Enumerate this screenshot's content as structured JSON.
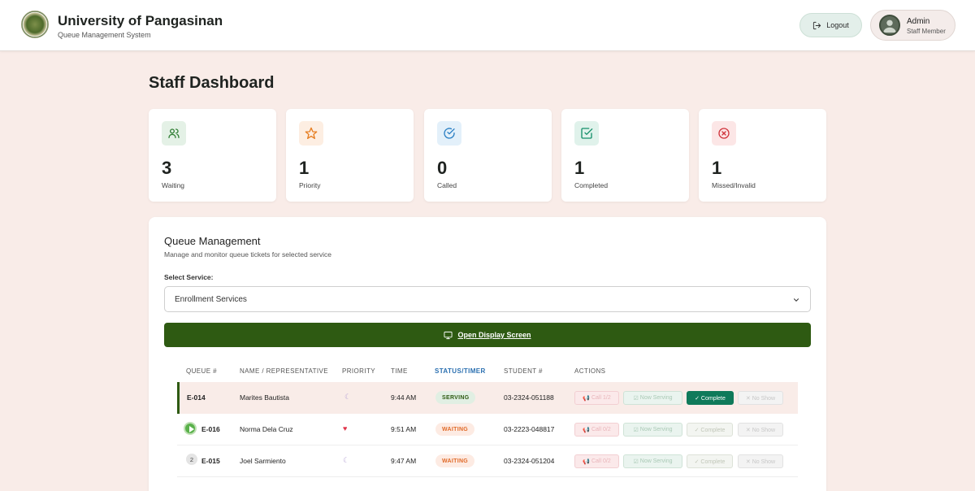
{
  "header": {
    "title": "University of Pangasinan",
    "subtitle": "Queue Management System",
    "logout_label": "Logout",
    "user_name": "Admin",
    "user_role": "Staff Member"
  },
  "page": {
    "title": "Staff Dashboard"
  },
  "stats": [
    {
      "value": "3",
      "label": "Waiting",
      "icon": "users-icon",
      "color": "#2e7d32"
    },
    {
      "value": "1",
      "label": "Priority",
      "icon": "star-icon",
      "color": "#e67e22"
    },
    {
      "value": "0",
      "label": "Called",
      "icon": "check-circle-icon",
      "color": "#2a7fc4"
    },
    {
      "value": "1",
      "label": "Completed",
      "icon": "check-square-icon",
      "color": "#148f69"
    },
    {
      "value": "1",
      "label": "Missed/Invalid",
      "icon": "x-circle-icon",
      "color": "#d0343c"
    }
  ],
  "queue": {
    "title": "Queue Management",
    "subtitle": "Manage and monitor queue tickets for selected service",
    "service_label": "Select Service:",
    "service_value": "Enrollment Services",
    "display_button": "Open Display Screen",
    "columns": [
      "QUEUE #",
      "NAME / REPRESENTATIVE",
      "PRIORITY",
      "TIME",
      "STATUS/TIMER",
      "STUDENT #",
      "ACTIONS"
    ],
    "rows": [
      {
        "queue_no": "E-014",
        "name": "Marites Bautista",
        "priority": "☾",
        "time": "9:44 AM",
        "status": "SERVING",
        "student_no": "03-2324-051188",
        "call": "Call 1/2",
        "marker": ""
      },
      {
        "queue_no": "E-016",
        "name": "Norma Dela Cruz",
        "priority": "♥",
        "time": "9:51 AM",
        "status": "WAITING",
        "student_no": "03-2223-048817",
        "call": "Call 0/2",
        "marker": "play"
      },
      {
        "queue_no": "E-015",
        "name": "Joel Sarmiento",
        "priority": "☾",
        "time": "9:47 AM",
        "status": "WAITING",
        "student_no": "03-2324-051204",
        "call": "Call 0/2",
        "marker": "2"
      }
    ],
    "actions": {
      "now_serving": "Now Serving",
      "complete": "✓ Complete",
      "no_show": "✕ No Show"
    }
  },
  "colors": {
    "brand_green": "#2e5a12",
    "page_bg": "#f9ece8",
    "accent_teal": "#0f7a5a"
  }
}
